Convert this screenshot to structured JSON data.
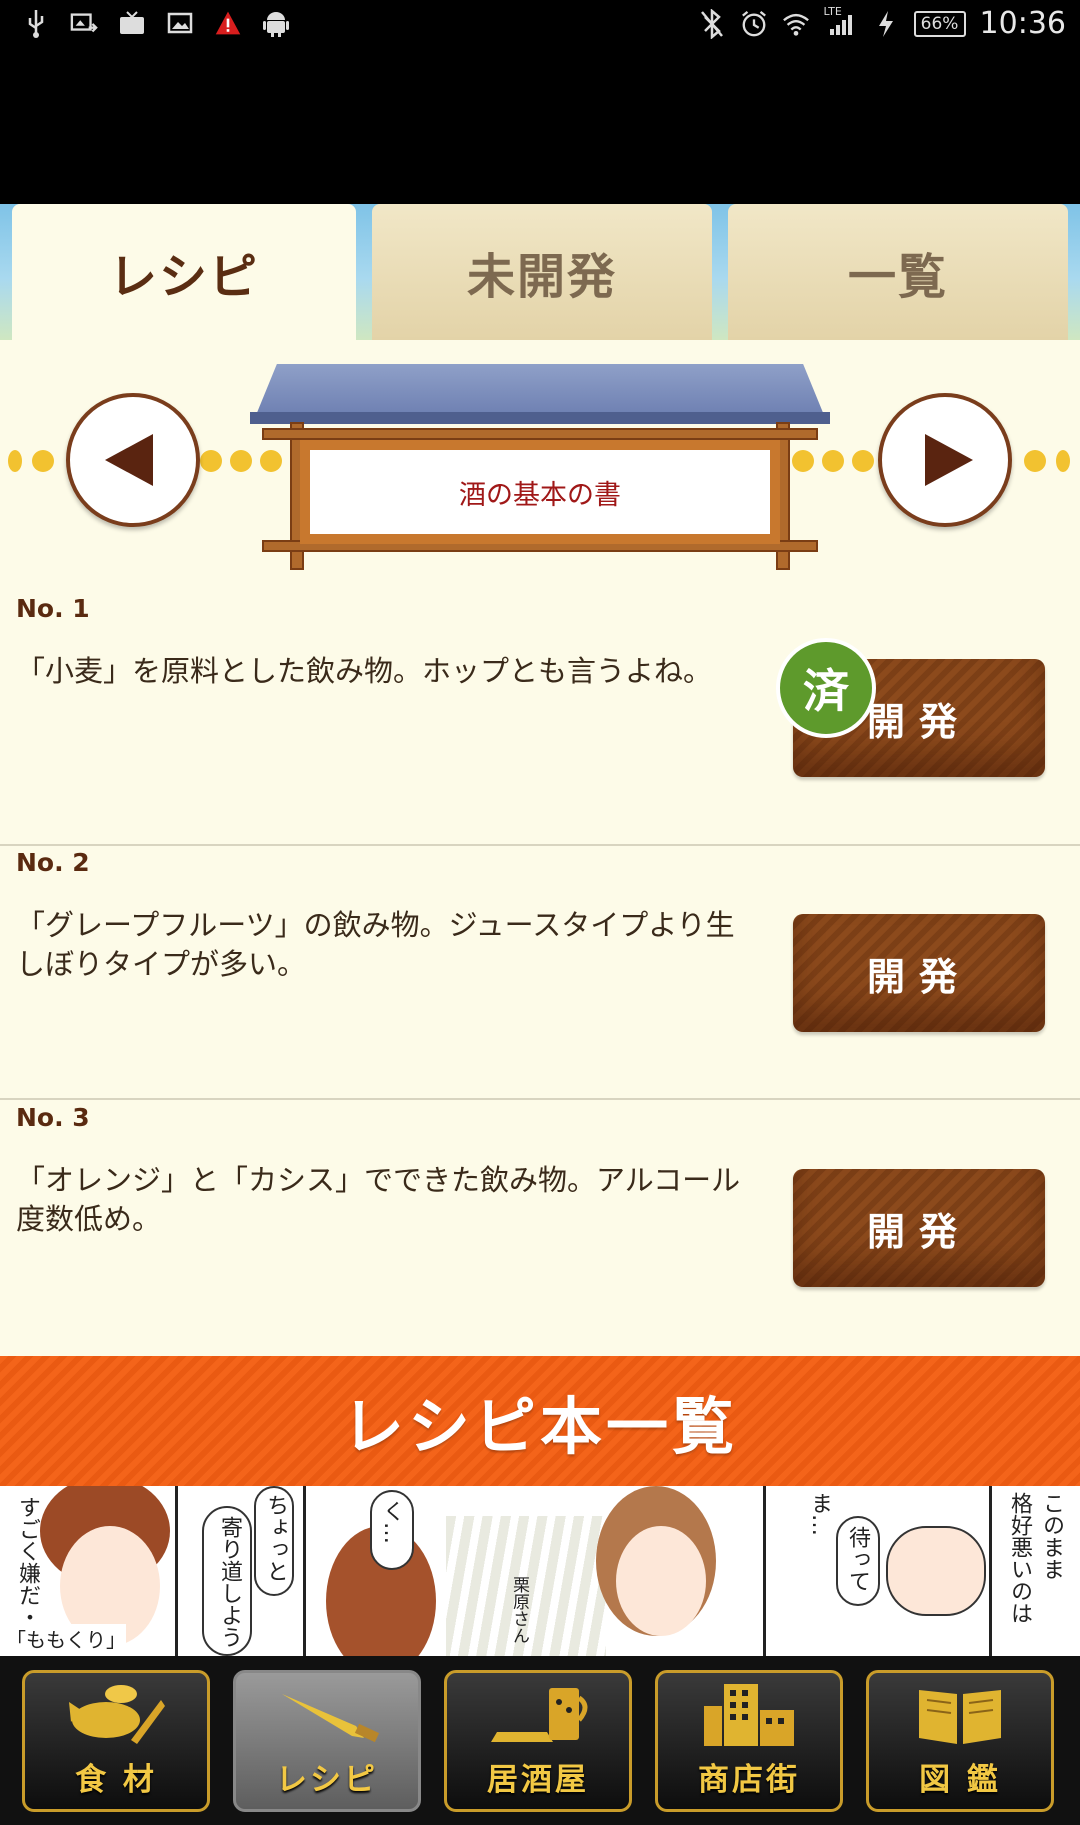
{
  "status_bar": {
    "time": "10:36",
    "battery": "66%",
    "network": "LTE",
    "left_icons": [
      "usb-icon",
      "photo-sync-icon",
      "tv-icon",
      "image-icon",
      "warning-icon",
      "android-icon"
    ],
    "right_icons": [
      "bluetooth-off-icon",
      "alarm-icon",
      "wifi-icon",
      "signal-icon",
      "charging-icon"
    ]
  },
  "tabs": [
    {
      "label": "レシピ",
      "active": true
    },
    {
      "label": "未開発",
      "active": false
    },
    {
      "label": "一覧",
      "active": false
    }
  ],
  "book": {
    "title": "酒の基本の書"
  },
  "recipes": [
    {
      "no": "No. 1",
      "desc": "「小麦」を原料とした飲み物。ホップとも言うよね。",
      "button": "開発",
      "done_badge": "済"
    },
    {
      "no": "No. 2",
      "desc": "「グレープフルーツ」の飲み物。ジュースタイプより生しぼりタイプが多い。",
      "button": "開発"
    },
    {
      "no": "No. 3",
      "desc": "「オレンジ」と「カシス」でできた飲み物。アルコール度数低め。",
      "button": "開発"
    }
  ],
  "banner": {
    "label": "レシピ本一覧"
  },
  "manga_ad": {
    "texts": [
      "すごく嫌だ・",
      "「ももくり」",
      "寄り道しよう",
      "ちょっと",
      "く…",
      "栗原さん",
      "ま…",
      "待って",
      "このまま",
      "格好悪いのは"
    ]
  },
  "bottom_nav": [
    {
      "label": "食 材",
      "icon": "ingredients-icon",
      "active": false
    },
    {
      "label": "レシピ",
      "icon": "knife-icon",
      "active": true
    },
    {
      "label": "居酒屋",
      "icon": "izakaya-icon",
      "active": false
    },
    {
      "label": "商店街",
      "icon": "shopping-street-icon",
      "active": false
    },
    {
      "label": "図 鑑",
      "icon": "book-icon",
      "active": false
    }
  ],
  "colors": {
    "accent_brown": "#7a3d1c",
    "badge_green": "#5e9a2c",
    "banner_orange": "#f4641a",
    "nav_gold": "#f2c844"
  }
}
